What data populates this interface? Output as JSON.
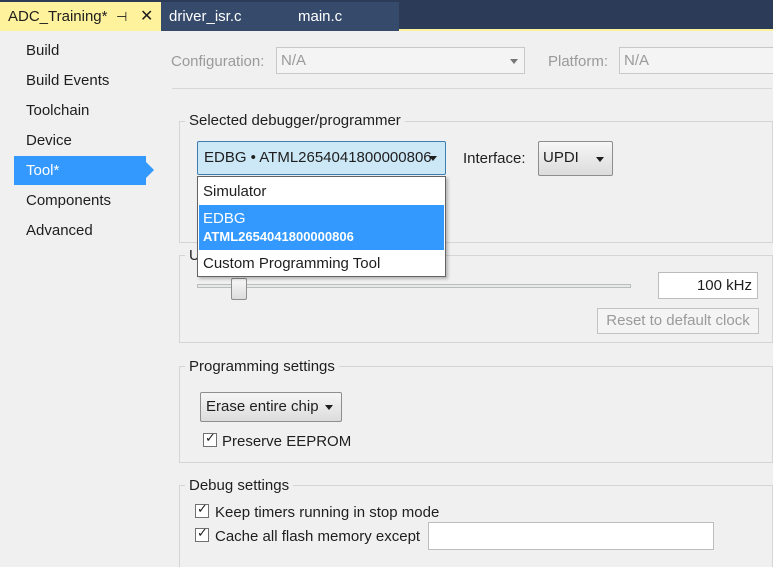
{
  "tabs": [
    {
      "label": "ADC_Training*",
      "active": true,
      "pin_icon": "pin-icon",
      "close_icon": "close-icon"
    },
    {
      "label": "driver_isr.c",
      "active": false
    },
    {
      "label": "main.c",
      "active": false
    }
  ],
  "nav": {
    "items": [
      {
        "label": "Build",
        "selected": false
      },
      {
        "label": "Build Events",
        "selected": false
      },
      {
        "label": "Toolchain",
        "selected": false
      },
      {
        "label": "Device",
        "selected": false
      },
      {
        "label": "Tool*",
        "selected": true
      },
      {
        "label": "Components",
        "selected": false
      },
      {
        "label": "Advanced",
        "selected": false
      }
    ]
  },
  "config": {
    "configuration_label": "Configuration:",
    "configuration_value": "N/A",
    "platform_label": "Platform:",
    "platform_value": "N/A"
  },
  "debugger": {
    "group_title": "Selected debugger/programmer",
    "selected_value": "EDBG • ATML2654041800000806",
    "interface_label": "Interface:",
    "interface_value": "UPDI",
    "dropdown_options": [
      {
        "label": "Simulator",
        "sublabel": ""
      },
      {
        "label": "EDBG",
        "sublabel": "ATML2654041800000806",
        "highlighted": true
      },
      {
        "label": "Custom Programming Tool",
        "sublabel": ""
      }
    ]
  },
  "clock": {
    "group_title_partial": "U",
    "value": "100 kHz",
    "reset_button": "Reset to default clock"
  },
  "programming": {
    "group_title": "Programming settings",
    "erase_value": "Erase entire chip",
    "preserve_eeprom_label": "Preserve EEPROM",
    "preserve_eeprom_checked": true
  },
  "debug": {
    "group_title": "Debug settings",
    "keep_timers_label": "Keep timers running in stop mode",
    "keep_timers_checked": true,
    "cache_flash_label": "Cache all flash memory except",
    "cache_flash_checked": true,
    "cache_flash_value": ""
  },
  "colors": {
    "active_tab": "#fff29d",
    "tab_strip": "#2b3b58",
    "selection": "#3399ff",
    "open_combo": "#cce8f7"
  }
}
